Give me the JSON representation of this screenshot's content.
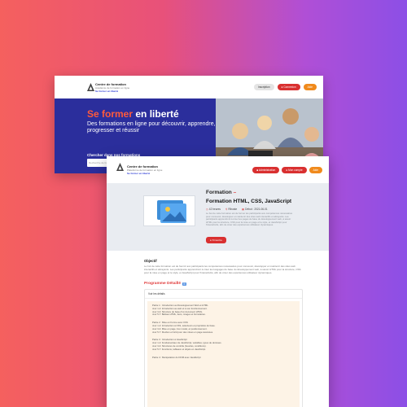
{
  "back_window": {
    "brand": {
      "name": "Centre de formation",
      "subtitle": "Académie de formation en ligne",
      "tagline": "Se former en liberté"
    },
    "header_buttons": {
      "inscription": "Inscription",
      "connexion": "Connexion",
      "cta": "Aide"
    },
    "hero": {
      "title_accent": "Se former",
      "title_rest": " en liberté",
      "subtitle": "Des formations en ligne pour découvrir, apprendre, progresser et réussir",
      "search_label": "Chercher dans nos formations",
      "search_placeholder": "Recherche de formation"
    }
  },
  "front_window": {
    "brand": {
      "name": "Centre de formation",
      "subtitle": "Plateforme de formation en ligne",
      "tagline": "Se former en liberté"
    },
    "header_buttons": {
      "admin": "Administration",
      "account": "Mon compte",
      "cta": "Aide"
    },
    "course": {
      "kicker": "Formation",
      "title": "Formation HTML, CSS, JavaScript",
      "meta": [
        {
          "icon": "clock-icon",
          "text": "42 heures"
        },
        {
          "icon": "location-icon",
          "text": "Rihoste"
        },
        {
          "icon": "calendar-icon",
          "text": "Début : 2021-06-01"
        }
      ],
      "description": "Le but de cette formation est de former les participants aux compétences nécessaires pour concevoir, développer et maintenir des sites web interactifs et attrayants. Les participants apprendront à créer les pages de base du développement web, à savoir HTML pour la structure, CSS pour la mise en page et le style, et JavaScript pour l'interactivité, afin de créer des expériences utilisateur dynamiques.",
      "button": "S'inscrire"
    },
    "objectif": {
      "title": "Objectif",
      "text": "Le but de cette formation est de fournir aux participants les compétences nécessaires pour concevoir, développer et maintenir des sites web interactifs et attrayants. Les participants apprendront à créer les langages de base du développement web, à savoir HTML pour la structure, CSS pour la mise en page et le style, et JavaScript pour l'interactivité, afin de créer des expériences utilisateur dynamiques."
    },
    "programme": {
      "title": "Programme Détaillé",
      "summary": "Voir les détails",
      "parts": [
        [
          "Partie 1 : Introduction au Développement Web et HTML",
          "Jour 1-2: Introduction au web et à son fonctionnement.",
          "Jour 3-4: Structure de base d'un document HTML.",
          "Jour 5-7: Balises HTML, liens, images et formulaires."
        ],
        [
          "Partie 2 : Mise en Forme avec CSS",
          "Jour 1-2: Introduction à CSS, sélecteurs et propriétés de base.",
          "Jour 3-4: Mise en page, box model, et positionnement.",
          "Jour 5-7: Flexbox et Grid pour des mises en page avancées."
        ],
        [
          "Partie 3 : Introduction à JavaScript",
          "Jour 1-2: Fondamentaux de JavaScript, variables, types de données.",
          "Jour 3-4: Structures de contrôle (boucles, conditions).",
          "Jour 5-7: Fonctions, tableaux et objets en JavaScript."
        ],
        [
          "Partie 4 : Manipulation du DOM avec JavaScript"
        ]
      ]
    }
  },
  "colors": {
    "hero_blue": "#2b2e9c",
    "accent_red": "#d93030",
    "accent_orange": "#f08a1c",
    "band_grey": "#e9ecf1"
  }
}
